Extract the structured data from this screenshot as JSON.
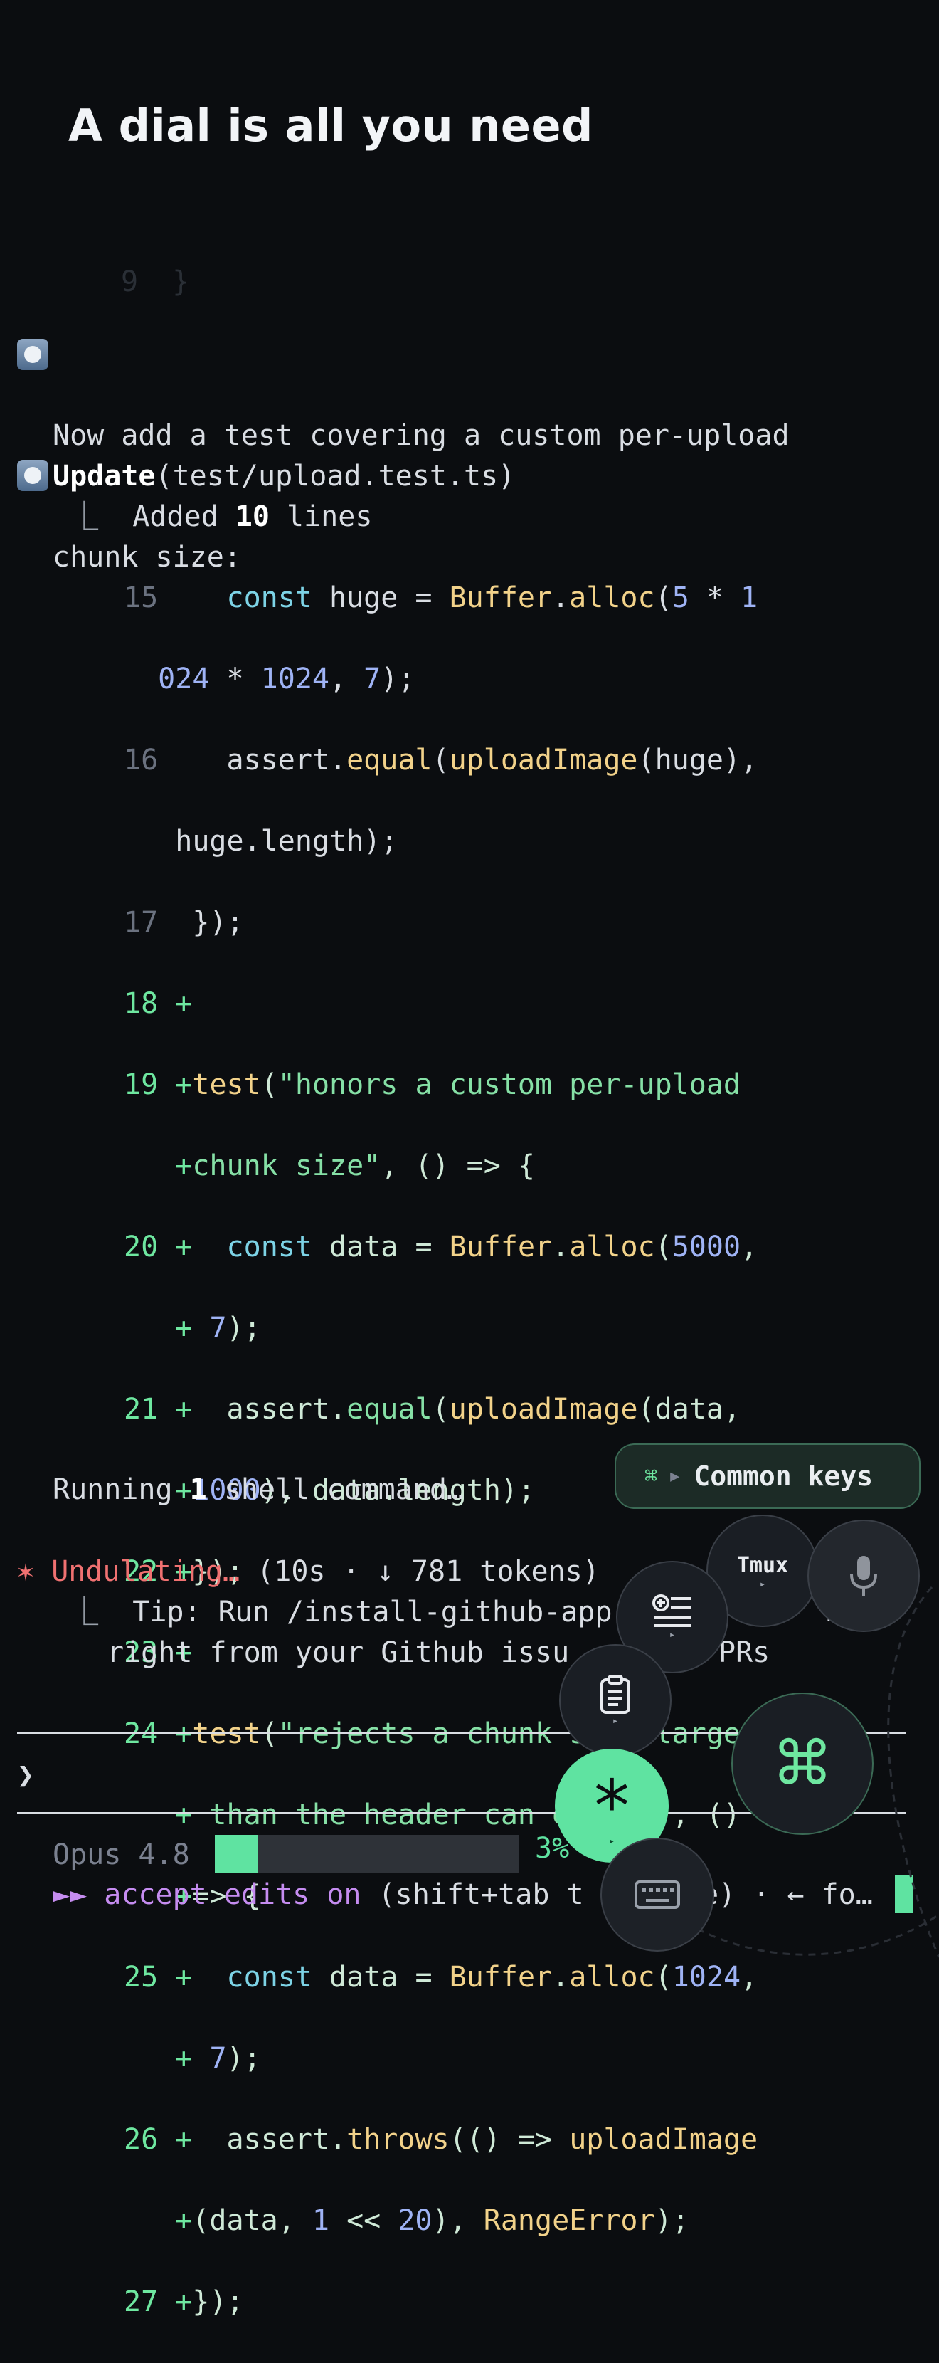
{
  "header": {
    "title": "A dial is all you need"
  },
  "transcript": {
    "faded_fragment": "9  }",
    "message": [
      "Now add a test covering a custom per-upload",
      "chunk size:"
    ],
    "update": {
      "verb": "Update",
      "path": "(test/upload.test.ts)"
    },
    "added": {
      "prefix": "Added ",
      "count": "10",
      "suffix": " lines"
    },
    "running": {
      "prefix": "Running ",
      "count": "1",
      "suffix": " shell command…"
    },
    "status": {
      "star": "✶",
      "word": "Undulating…",
      "meta": " (10s · ↓ 781 tokens)",
      "tip_line1": "Tip: Run /install-github-app ",
      "tip_line1_end": "ia",
      "tip_line2": "right from your Github issu",
      "tip_line2_end": "PRs"
    }
  },
  "diff": {
    "lines": [
      {
        "n": "15",
        "kind": "ctx"
      },
      {
        "n": "16",
        "kind": "ctx"
      },
      {
        "n": "17",
        "kind": "ctx"
      },
      {
        "n": "18",
        "kind": "add"
      },
      {
        "n": "19",
        "kind": "add"
      },
      {
        "n": "20",
        "kind": "add"
      },
      {
        "n": "21",
        "kind": "add"
      },
      {
        "n": "22",
        "kind": "add"
      },
      {
        "n": "23",
        "kind": "add"
      },
      {
        "n": "24",
        "kind": "add"
      },
      {
        "n": "25",
        "kind": "add"
      },
      {
        "n": "26",
        "kind": "add"
      },
      {
        "n": "27",
        "kind": "add"
      }
    ]
  },
  "input": {
    "prompt_symbol": "❯",
    "value": ""
  },
  "footer": {
    "model": "Opus 4.8",
    "context_percent": 3,
    "context_label": "3%",
    "mode_arrows": "►►",
    "mode": "accept edits on",
    "mode_hint": " (shift+tab t",
    "mode_hint_end": "e) · ← fo…"
  },
  "dial": {
    "common_keys": {
      "symbol": "⌘",
      "arrow": "▶",
      "label": "Common keys"
    },
    "tmux_label": "Tmux",
    "buttons": [
      "tmux-button",
      "mic-button",
      "new-list-button",
      "clipboard-button",
      "command-button",
      "asterisk-button",
      "keyboard-button"
    ]
  },
  "colors": {
    "accent": "#5fe3a1",
    "background": "#0b0d10",
    "alert": "#f07171",
    "mode": "#c58cf0"
  }
}
